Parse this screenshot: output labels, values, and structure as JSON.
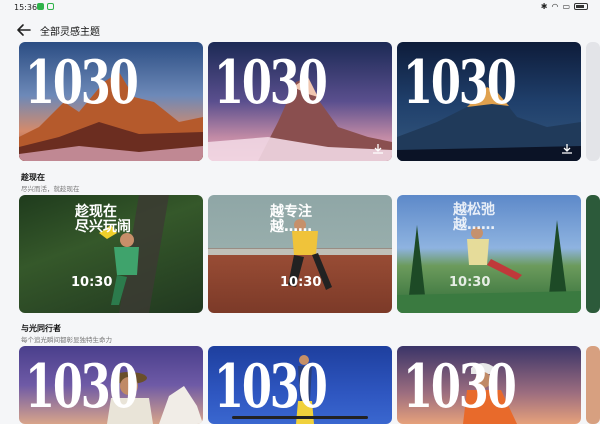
{
  "status_bar": {
    "time": "15:36"
  },
  "header": {
    "title": "全部灵感主题"
  },
  "sections": [
    {
      "title": "趁现在",
      "subtitle": "尽兴而活，就趁现在"
    },
    {
      "title": "与光同行者",
      "subtitle": "每个追光瞬间都彰显独特生命力"
    }
  ],
  "cards": {
    "row1_time": "1030",
    "row2": [
      {
        "slogan": "趁现在\n尽兴玩闹",
        "time": "10:30"
      },
      {
        "slogan": "越专注\n越……",
        "time": "10:30"
      },
      {
        "slogan": "越松弛\n越……",
        "time": "10:30"
      }
    ],
    "row3_time": "1030"
  },
  "colors": {
    "accent": "#2fb34a",
    "background": "#f5f6f8"
  },
  "icons": [
    "back-arrow-icon",
    "download-icon",
    "wifi-icon",
    "bluetooth-icon",
    "battery-icon"
  ]
}
